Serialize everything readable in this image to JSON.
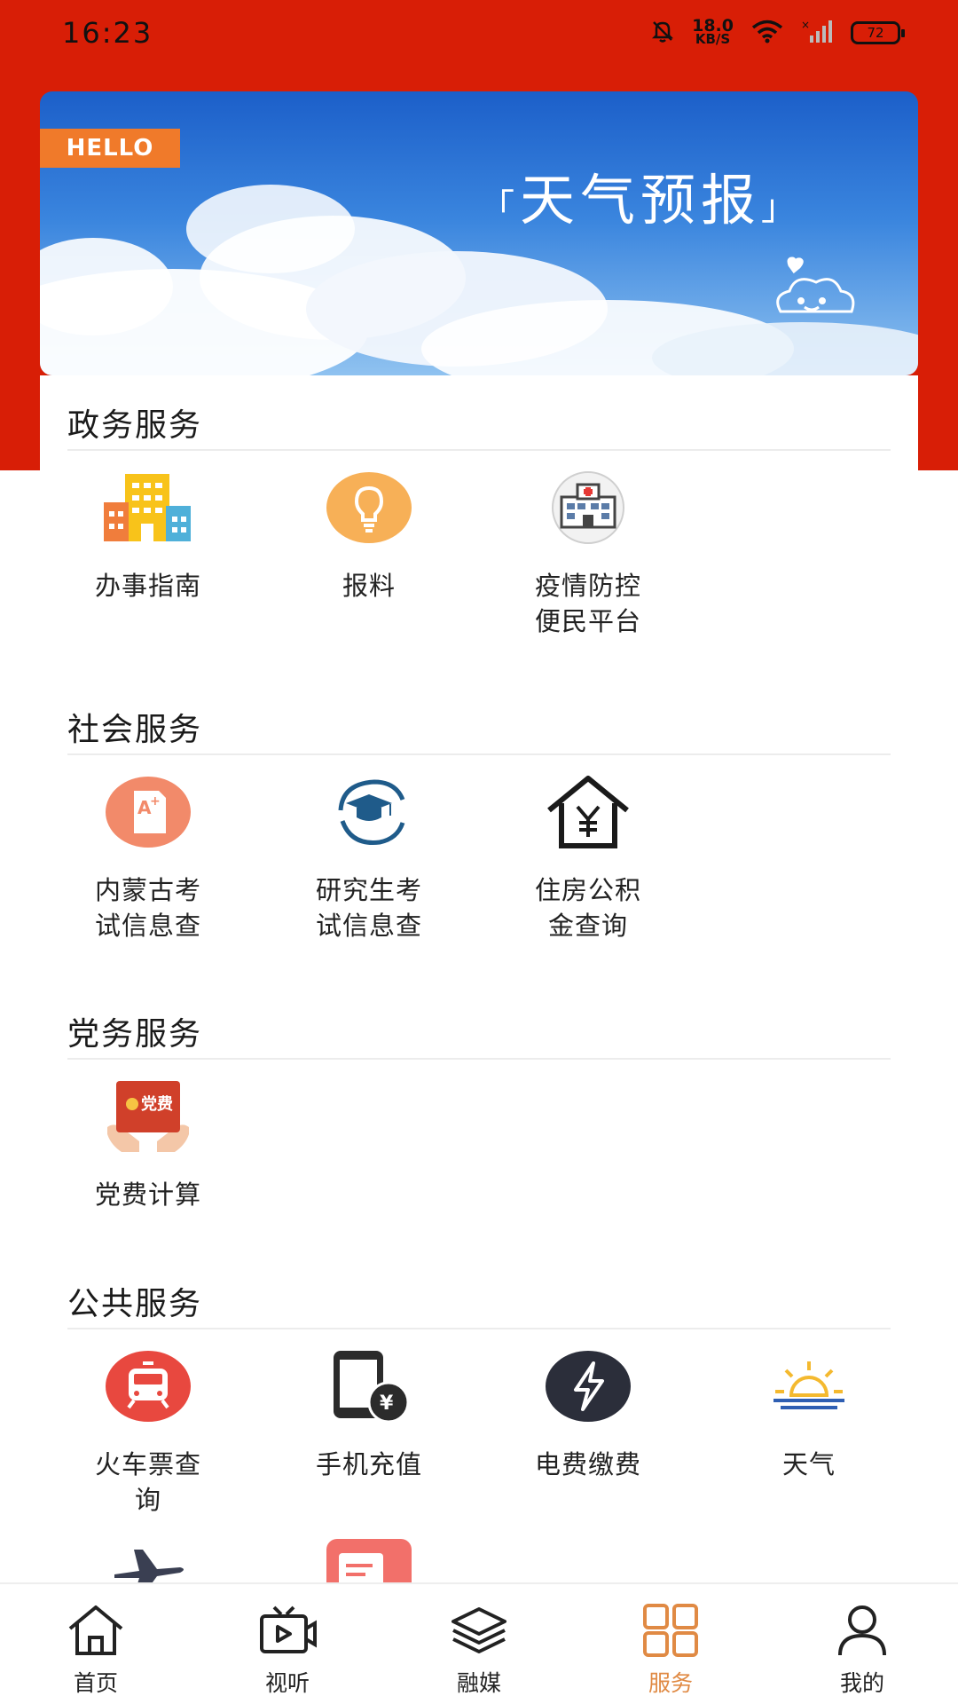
{
  "status_bar": {
    "time": "16:23",
    "net_speed_value": "18.0",
    "net_speed_unit": "KB/S",
    "battery": "72",
    "icons": [
      "mute-icon",
      "wifi-icon",
      "signal-icon",
      "battery-icon"
    ]
  },
  "banner": {
    "tag": "HELLO",
    "title": "天气预报",
    "bracket_left": "「",
    "bracket_right": "」"
  },
  "sections": {
    "gov": {
      "title": "政务服务",
      "items": [
        {
          "label": "办事指南",
          "icon": "buildings-icon"
        },
        {
          "label": "报料",
          "icon": "lightbulb-icon"
        },
        {
          "label_line1": "疫情防控",
          "label_line2": "便民平台",
          "icon": "hospital-icon"
        }
      ]
    },
    "social": {
      "title": "社会服务",
      "items": [
        {
          "label_line1": "内蒙古考",
          "label_line2": "试信息查",
          "icon": "exam-grade-icon"
        },
        {
          "label_line1": "研究生考",
          "label_line2": "试信息查",
          "icon": "graduation-cap-icon"
        },
        {
          "label_line1": "住房公积",
          "label_line2": "金查询",
          "icon": "house-yuan-icon"
        }
      ]
    },
    "party": {
      "title": "党务服务",
      "items": [
        {
          "label": "党费计算",
          "icon": "party-fee-icon",
          "badge": "党费"
        }
      ]
    },
    "public": {
      "title": "公共服务",
      "items": [
        {
          "label_line1": "火车票查",
          "label_line2": "询",
          "icon": "train-icon"
        },
        {
          "label": "手机充值",
          "icon": "phone-recharge-icon",
          "badge": "¥"
        },
        {
          "label": "电费缴费",
          "icon": "lightning-icon"
        },
        {
          "label": "天气",
          "icon": "sunrise-icon"
        }
      ]
    }
  },
  "tab_bar": {
    "tabs": [
      {
        "label": "首页",
        "icon": "home-icon"
      },
      {
        "label": "视听",
        "icon": "tv-play-icon"
      },
      {
        "label": "融媒",
        "icon": "layers-icon"
      },
      {
        "label": "服务",
        "icon": "grid-icon",
        "active": true
      },
      {
        "label": "我的",
        "icon": "user-icon"
      }
    ]
  },
  "colors": {
    "brand_red": "#d81e06",
    "accent_orange": "#e08a44",
    "tag_orange": "#f07a2a"
  }
}
